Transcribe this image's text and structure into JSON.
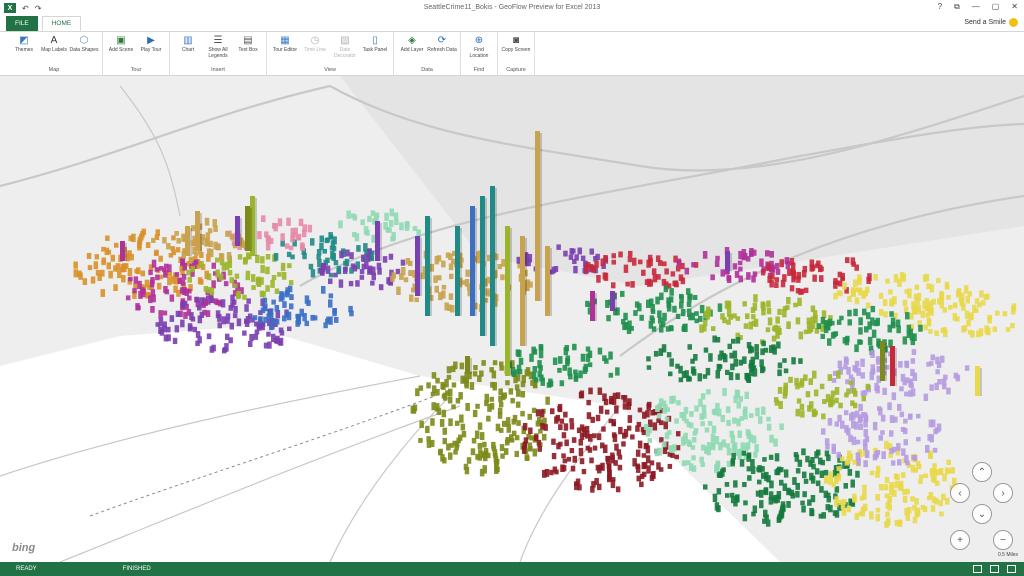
{
  "app": {
    "title": "SeattleCrime11_Bokis - GeoFlow Preview for Excel 2013",
    "excel_icon": "X",
    "undo_icon": "↶",
    "redo_icon": "↷",
    "window_controls": [
      "?",
      "⧉",
      "—",
      "▢",
      "✕"
    ]
  },
  "tabs": {
    "file": "FILE",
    "home": "HOME"
  },
  "send_smile": "Send a Smile",
  "ribbon": {
    "groups": [
      {
        "label": "Map",
        "buttons": [
          {
            "label": "Themes",
            "icon": "themes-icon",
            "glyph": "◩",
            "color": "#3b78c4",
            "enabled": true
          },
          {
            "label": "Map Labels",
            "icon": "map-labels-icon",
            "glyph": "A",
            "color": "#333333",
            "enabled": true
          },
          {
            "label": "Data Shapes",
            "icon": "data-shapes-icon",
            "glyph": "⬡",
            "color": "#6a8fbd",
            "enabled": true
          }
        ]
      },
      {
        "label": "Tour",
        "buttons": [
          {
            "label": "Add Scene",
            "icon": "add-scene-icon",
            "glyph": "▣",
            "color": "#2f7a3a",
            "enabled": true
          },
          {
            "label": "Play Tour",
            "icon": "play-tour-icon",
            "glyph": "▶",
            "color": "#2a6fb5",
            "enabled": true
          }
        ]
      },
      {
        "label": "Insert",
        "buttons": [
          {
            "label": "Chart",
            "icon": "chart-icon",
            "glyph": "▥",
            "color": "#3b78c4",
            "enabled": true
          },
          {
            "label": "Show All Legends",
            "icon": "legends-icon",
            "glyph": "☰",
            "color": "#555555",
            "enabled": true
          },
          {
            "label": "Text Box",
            "icon": "text-box-icon",
            "glyph": "▤",
            "color": "#555555",
            "enabled": true
          }
        ]
      },
      {
        "label": "View",
        "buttons": [
          {
            "label": "Tour Editor",
            "icon": "tour-editor-icon",
            "glyph": "▦",
            "color": "#3b78c4",
            "enabled": true
          },
          {
            "label": "Time Line",
            "icon": "time-line-icon",
            "glyph": "◷",
            "color": "#b3b3b3",
            "enabled": false
          },
          {
            "label": "Date Decorator",
            "icon": "date-decorator-icon",
            "glyph": "▧",
            "color": "#b3b3b3",
            "enabled": false
          },
          {
            "label": "Task Panel",
            "icon": "task-panel-icon",
            "glyph": "▯",
            "color": "#3b78c4",
            "enabled": true
          }
        ]
      },
      {
        "label": "Data",
        "buttons": [
          {
            "label": "Add Layer",
            "icon": "add-layer-icon",
            "glyph": "◈",
            "color": "#2f7a3a",
            "enabled": true
          },
          {
            "label": "Refresh Data",
            "icon": "refresh-data-icon",
            "glyph": "⟳",
            "color": "#2a6fb5",
            "enabled": true
          }
        ]
      },
      {
        "label": "Find",
        "buttons": [
          {
            "label": "Find Location",
            "icon": "find-location-icon",
            "glyph": "⊕",
            "color": "#2a6fb5",
            "enabled": true
          }
        ]
      },
      {
        "label": "Capture",
        "buttons": [
          {
            "label": "Copy Screen",
            "icon": "camera-icon",
            "glyph": "◙",
            "color": "#444444",
            "enabled": true
          }
        ]
      }
    ]
  },
  "map": {
    "logo": "bing",
    "scale_text": "0.5 Miles",
    "nav": {
      "up": "⌃",
      "down": "⌄",
      "left": "‹",
      "right": "›",
      "zoom_in": "+",
      "zoom_out": "−"
    },
    "colors": {
      "purple": "#7a3fb0",
      "magenta": "#b0309a",
      "teal": "#1f8a86",
      "olive": "#7d8a1a",
      "lime": "#9bb52a",
      "green": "#1f8f4c",
      "dark_green": "#157a3e",
      "mint": "#8fd9b3",
      "yellow": "#e8d84a",
      "lavender": "#b59be0",
      "orange": "#d9902a",
      "red": "#c8283a",
      "dark_red": "#8c1a24",
      "tan": "#c8a24c",
      "salmon": "#e48aa8",
      "blue": "#3a6fc4"
    }
  },
  "status": {
    "left": "READY",
    "middle": "FINISHED"
  }
}
